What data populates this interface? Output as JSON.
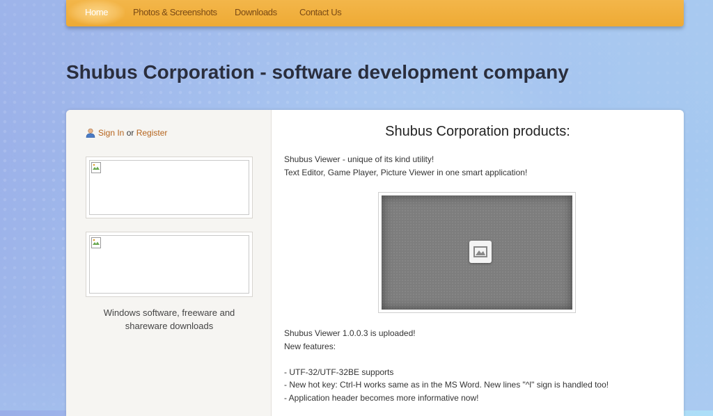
{
  "nav": {
    "items": [
      {
        "label": "Home",
        "active": true
      },
      {
        "label": "Photos & Screenshots",
        "active": false
      },
      {
        "label": "Downloads",
        "active": false
      },
      {
        "label": "Contact Us",
        "active": false
      }
    ]
  },
  "header": {
    "title": "Shubus Corporation - software development company"
  },
  "sidebar": {
    "sign_in": "Sign In",
    "or": "or",
    "register": "Register",
    "caption_line1": "Windows software, freeware and",
    "caption_line2": "shareware downloads"
  },
  "main": {
    "title": "Shubus Corporation products:",
    "intro_line1": "Shubus Viewer - unique of its kind utility!",
    "intro_line2": "Text Editor, Game Player, Picture Viewer in one smart application!",
    "news_line1": "Shubus Viewer 1.0.0.3 is uploaded!",
    "news_line2": "New features:",
    "features": [
      "- UTF-32/UTF-32BE supports",
      "- New hot key: Ctrl-H works same as in the MS Word. New lines \"^l\" sign is handled too!",
      "- Application header becomes more informative now!"
    ]
  },
  "colors": {
    "nav_bg": "#eeaa34",
    "nav_text": "#7a4a15",
    "link": "#b5641d",
    "title": "#2a2e3d"
  },
  "icons": {
    "user": "user-icon",
    "broken_image": "broken-image-icon",
    "image_placeholder": "image-placeholder-icon"
  }
}
